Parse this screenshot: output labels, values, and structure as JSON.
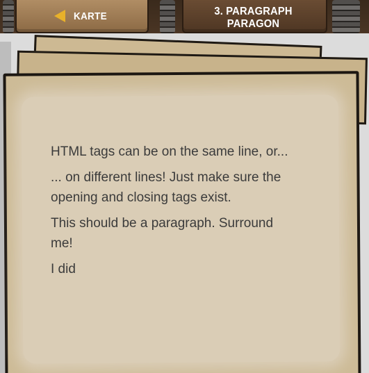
{
  "header": {
    "back_label": "KARTE",
    "level_title": "3. PARAGRAPH PARAGON"
  },
  "page": {
    "paragraphs": [
      "HTML tags can be on the same line, or...",
      "... on different lines! Just make sure the opening and closing tags exist.",
      "This should be a paragraph. Surround me!",
      "I did"
    ]
  },
  "colors": {
    "parchment": "#dacdb6",
    "parchment_edge": "#cdbb97",
    "wood": "#8c6a45",
    "accent_arrow": "#e8b12a",
    "text": "#3b3b3b"
  },
  "icons": {
    "back": "arrow-left-icon"
  }
}
